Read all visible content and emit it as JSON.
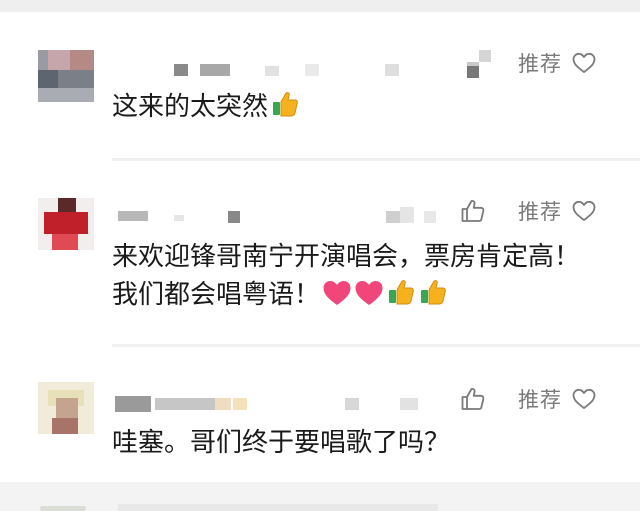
{
  "comments": [
    {
      "text": "这来的太突然",
      "emojis": [
        "thumbs-up"
      ],
      "recommend_label": "推荐",
      "has_like_button": false
    },
    {
      "text_line1": "来欢迎锋哥南宁开演唱会，票房肯定高！",
      "text_line2": "我们都会唱粤语！",
      "emojis": [
        "red-heart",
        "red-heart",
        "thumbs-up",
        "thumbs-up"
      ],
      "recommend_label": "推荐",
      "has_like_button": true
    },
    {
      "text": "哇塞。哥们终于要唱歌了吗？",
      "recommend_label": "推荐",
      "has_like_button": true
    }
  ],
  "colors": {
    "text": "#1a1a1a",
    "action_gray": "#7a7a7a",
    "divider": "#f0f0f0",
    "heart_emoji": "#f0467a",
    "thumb_emoji": "#f5b21e"
  }
}
